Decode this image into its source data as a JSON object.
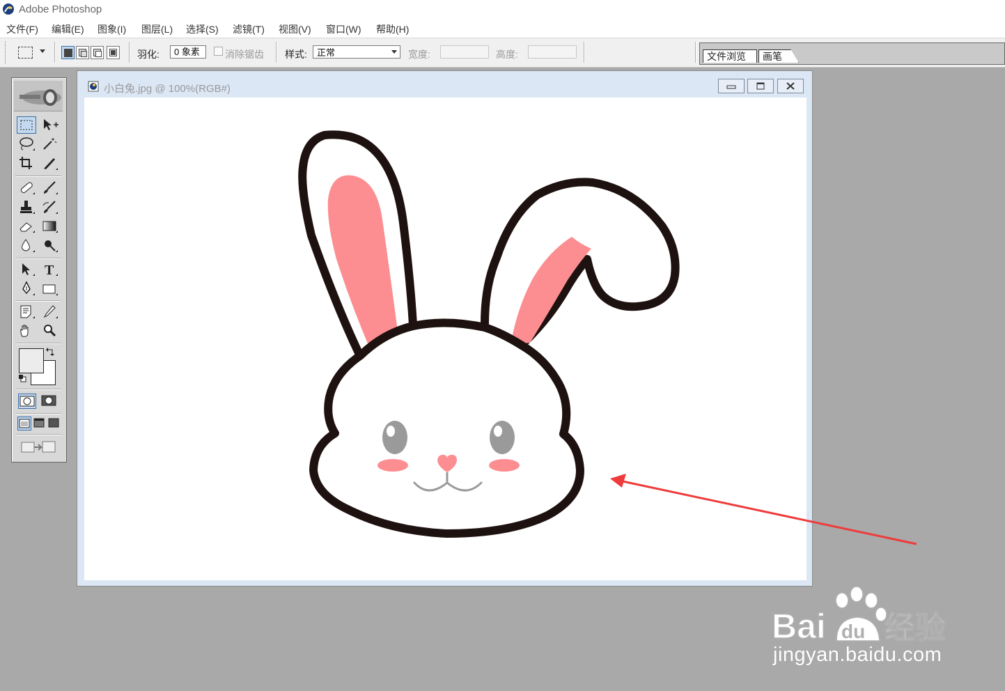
{
  "app": {
    "title": "Adobe Photoshop"
  },
  "menu": [
    {
      "label": "文件(F)"
    },
    {
      "label": "编辑(E)"
    },
    {
      "label": "图象(I)"
    },
    {
      "label": "图层(L)"
    },
    {
      "label": "选择(S)"
    },
    {
      "label": "滤镜(T)"
    },
    {
      "label": "视图(V)"
    },
    {
      "label": "窗口(W)"
    },
    {
      "label": "帮助(H)"
    }
  ],
  "options": {
    "feather_label": "羽化:",
    "feather_value": "0 象素",
    "antialias_label": "消除锯齿",
    "style_label": "样式:",
    "style_value": "正常",
    "width_label": "宽度:",
    "height_label": "高度:"
  },
  "palette_tabs": [
    {
      "label": "文件浏览"
    },
    {
      "label": "画笔"
    }
  ],
  "document": {
    "title": "小白兔.jpg @ 100%(RGB#)"
  },
  "watermark": {
    "text": "jingyan.baidu.com",
    "logo_text": "Bai du 经验"
  },
  "colors": {
    "workspace": "#a9a9a9",
    "ear_pink": "#fc8e92",
    "outline": "#1e1210",
    "arrow": "#ee3b3b",
    "eye": "#9a9a9a"
  }
}
